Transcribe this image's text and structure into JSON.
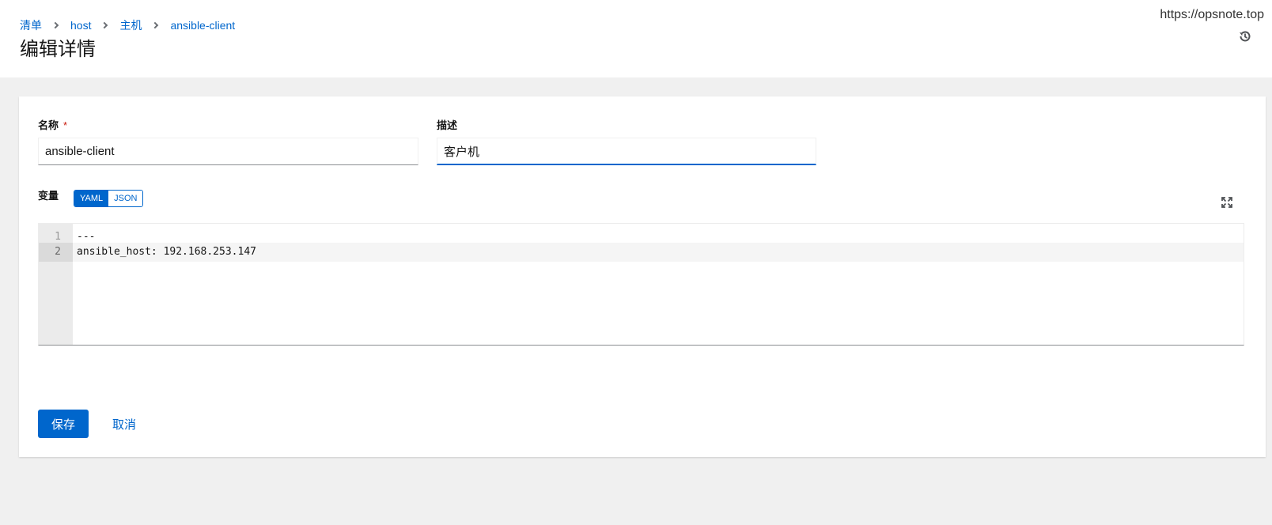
{
  "header": {
    "breadcrumb": [
      "清单",
      "host",
      "主机",
      "ansible-client"
    ],
    "title": "编辑详情",
    "watermark": "https://opsnote.top",
    "history_icon": "history-icon"
  },
  "form": {
    "name_label": "名称",
    "required_mark": "*",
    "name_value": "ansible-client",
    "description_label": "描述",
    "description_value": "客户机",
    "variables_label": "变量",
    "format_toggle": {
      "yaml": "YAML",
      "json": "JSON",
      "selected": "YAML"
    },
    "expand_icon": "expand-icon",
    "editor": {
      "lines": [
        {
          "num": "1",
          "code": "---"
        },
        {
          "num": "2",
          "code": "ansible_host: 192.168.253.147"
        }
      ],
      "active_line": 2
    }
  },
  "actions": {
    "save_label": "保存",
    "cancel_label": "取消"
  },
  "colors": {
    "accent": "#0066cc",
    "required": "#c9190b",
    "page_background": "#f0f0f0"
  }
}
